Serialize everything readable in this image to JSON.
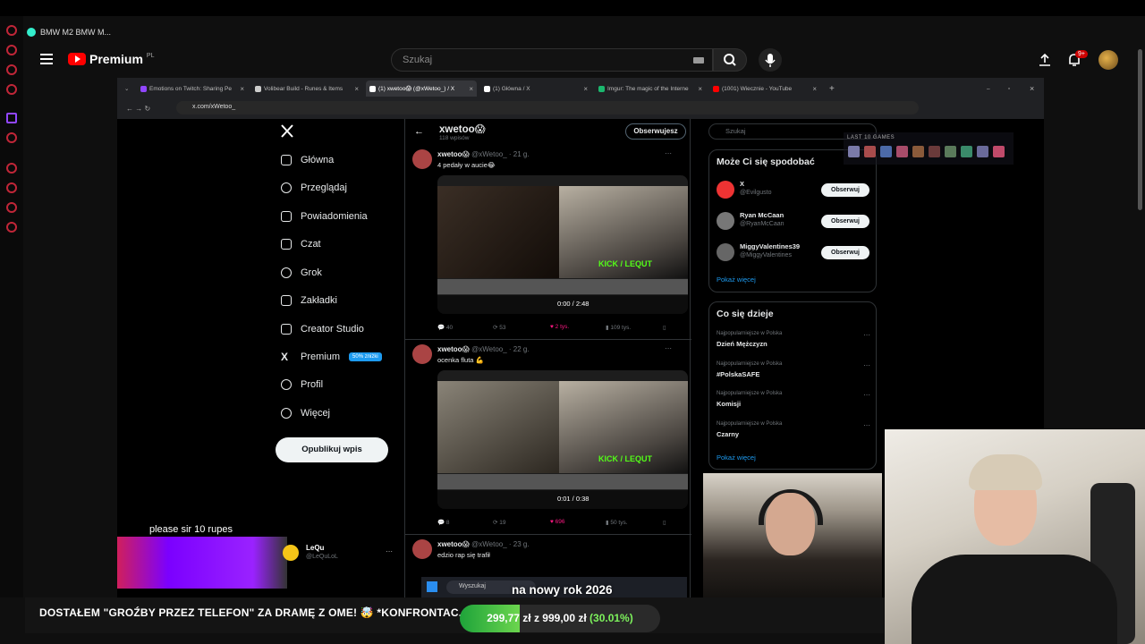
{
  "youtube": {
    "tab_title": "BMW M2 BMW M...",
    "logo_text": "Premium",
    "logo_region": "PL",
    "search_placeholder": "Szukaj",
    "notifications_badge": "9+"
  },
  "chrome": {
    "tabs": [
      {
        "label": "Emotions on Twitch: Sharing Pe",
        "color": "#9146ff"
      },
      {
        "label": "Volibear Build - Runes & Items",
        "color": "#cccccc"
      },
      {
        "label": "(1) xwetoo😱 (@xWetoo_) / X",
        "color": "#ffffff",
        "active": true
      },
      {
        "label": "(1) Główna / X",
        "color": "#ffffff"
      },
      {
        "label": "Imgur: The magic of the Interne",
        "color": "#1bb76e"
      },
      {
        "label": "(1001) Wiecznie - YouTube",
        "color": "#ff0000"
      }
    ],
    "url": "x.com/xWetoo_"
  },
  "x": {
    "nav": [
      {
        "label": "Główna",
        "icon": "home-icon"
      },
      {
        "label": "Przeglądaj",
        "icon": "search-icon"
      },
      {
        "label": "Powiadomienia",
        "icon": "bell-icon"
      },
      {
        "label": "Czat",
        "icon": "mail-icon"
      },
      {
        "label": "Grok",
        "icon": "grok-icon"
      },
      {
        "label": "Zakładki",
        "icon": "bookmark-icon"
      },
      {
        "label": "Creator Studio",
        "icon": "creator-icon"
      },
      {
        "label": "Premium",
        "icon": "x-logo-icon"
      },
      {
        "label": "Profil",
        "icon": "person-icon"
      },
      {
        "label": "Więcej",
        "icon": "more-icon"
      }
    ],
    "premium_tag": "50% zniżki",
    "publish_label": "Opublikuj wpis",
    "profile": {
      "name": "xwetoo😱",
      "posts": "118 wpisów",
      "follow_label": "Obserwujesz"
    },
    "tweets": [
      {
        "name": "xwetoo😱",
        "handle": "@xWetoo_ · 21 g.",
        "text": "4 pedały w aucie😂",
        "time": "0:00 / 2:48",
        "kick": "KICK / LEQUT",
        "replies": "40",
        "reposts": "53",
        "likes": "2 tys.",
        "views": "109 tys."
      },
      {
        "name": "xwetoo😱",
        "handle": "@xWetoo_ · 22 g.",
        "text": "ocenka fluta 💪",
        "time": "0:01 / 0:38",
        "kick": "KICK / LEQUT",
        "replies": "8",
        "reposts": "19",
        "likes": "696",
        "views": "50 tys."
      },
      {
        "name": "xwetoo😱",
        "handle": "@xWetoo_ · 23 g.",
        "text": "edzio rap się trafił"
      }
    ],
    "search_placeholder": "Szukaj",
    "suggest_title": "Może Ci się spodobać",
    "suggestions": [
      {
        "name": "X",
        "handle": "@Evilgusto",
        "btn": "Obserwuj"
      },
      {
        "name": "Ryan McCaan",
        "handle": "@RyanMcCaan",
        "btn": "Obserwuj"
      },
      {
        "name": "MiggyValentines39",
        "handle": "@MiggyValentines",
        "btn": "Obserwuj"
      }
    ],
    "show_more": "Pokaż więcej",
    "trends_title": "Co się dzieje",
    "trends": [
      {
        "category": "Najpopularniejsze w Polska",
        "name": "Dzień Mężczyzn"
      },
      {
        "category": "Najpopularniejsze w Polska",
        "name": "#PolskaSAFE"
      },
      {
        "category": "Najpopularniejsze w Polska",
        "name": "Komisji"
      },
      {
        "category": "Najpopularniejsze w Polska",
        "name": "Czarny"
      }
    ],
    "sidebar_account": {
      "name": "LeQu",
      "handle": "@LeQuLoL"
    }
  },
  "overlay": {
    "last_games_title": "LAST 10 GAMES",
    "donation_text": "please sir 10 rupes",
    "taskbar_search": "Wyszukaj",
    "new_year": "na nowy rok 2026",
    "headline": "DOSTAŁEM \"GROŹBY PRZEZ TELEFON\" ZA DRAMĘ Z OME! 🤯 *KONFRONTAC...",
    "goal_current": "299,77 zł",
    "goal_target": "z 999,00 zł",
    "goal_percent": "(30.01%)",
    "goal_fraction": 0.3001
  }
}
